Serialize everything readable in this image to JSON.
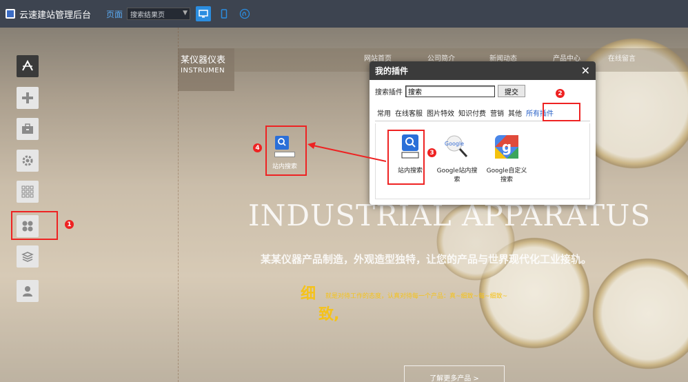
{
  "topbar": {
    "app_title": "云速建站管理后台",
    "page_label": "页面",
    "page_select": "搜索结果页",
    "device_desktop": "desktop-icon",
    "device_mobile": "mobile-icon",
    "device_other": "wechat-icon"
  },
  "site": {
    "logo_cn": "某仪器仪表",
    "logo_en": "INSTRUMEN",
    "nav": [
      "网站首页",
      "公司简介",
      "新闻动态",
      "产品中心",
      "在线留言"
    ],
    "hero_en": "INDUSTRIAL APPARATUS",
    "hero_cn": "某某仪器产品制造，外观造型独特，让您的产品与世界现代化工业接轨。",
    "detail_big_1": "细",
    "detail_big_2": "致,",
    "detail_small": "就是对待工作的态度，认真对待每一个产品：真~细致~每~细致~",
    "more_button": "了解更多产品 >",
    "dropped_widget_label": "站内搜索"
  },
  "badges": [
    "1",
    "2",
    "3",
    "4"
  ],
  "dialog": {
    "title": "我的插件",
    "close": "✕",
    "search_label": "搜索插件",
    "search_value": "搜索",
    "submit": "提交",
    "tabs": [
      "常用",
      "在线客服",
      "图片特效",
      "知识付费",
      "营销",
      "其他",
      "所有插件"
    ],
    "plugins": [
      {
        "label": "站内搜索",
        "icon": "site-search-icon"
      },
      {
        "label": "Google站内搜索",
        "icon": "google-search-icon"
      },
      {
        "label": "Google自定义搜索",
        "icon": "google-custom-search-icon"
      }
    ]
  },
  "colors": {
    "highlight": "#ee2222",
    "accent": "#2b8de0",
    "gold": "#f5c21a"
  }
}
